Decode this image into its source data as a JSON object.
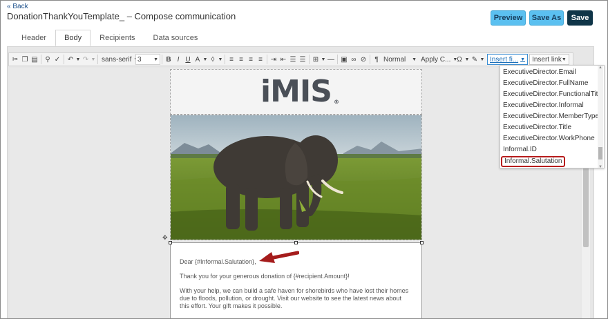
{
  "header": {
    "back_label": "« Back",
    "title": "DonationThankYouTemplate_ – Compose communication",
    "preview_label": "Preview",
    "save_as_label": "Save As",
    "save_label": "Save"
  },
  "tabs": [
    {
      "label": "Header"
    },
    {
      "label": "Body"
    },
    {
      "label": "Recipients"
    },
    {
      "label": "Data sources"
    }
  ],
  "toolbar": {
    "font_family": "sans-serif",
    "font_size": "3",
    "paragraph_format": "Normal",
    "apply_css": "Apply C...",
    "insert_field": "Insert fi...",
    "insert_link": "Insert link"
  },
  "insert_field_options": [
    "ExecutiveDirector.Email",
    "ExecutiveDirector.FullName",
    "ExecutiveDirector.FunctionalTitle",
    "ExecutiveDirector.Informal",
    "ExecutiveDirector.MemberType",
    "ExecutiveDirector.Title",
    "ExecutiveDirector.WorkPhone",
    "Informal.ID",
    "Informal.Salutation"
  ],
  "email_body": {
    "logo_text": "iMIS",
    "greeting": "Dear {#Informal.Salutation},",
    "line1": "Thank you for your generous donation of {#recipient.Amount}!",
    "line2": "With your help, we can build a safe haven for shorebirds who have lost their homes due to floods, pollution, or drought. Visit our website to see the latest news about this effort. Your gift makes it possible."
  },
  "colors": {
    "accent": "#5bc0f0",
    "primary_dark": "#0f3548",
    "highlight_outline": "#b71c1c",
    "annotation_arrow": "#a51c1c"
  }
}
